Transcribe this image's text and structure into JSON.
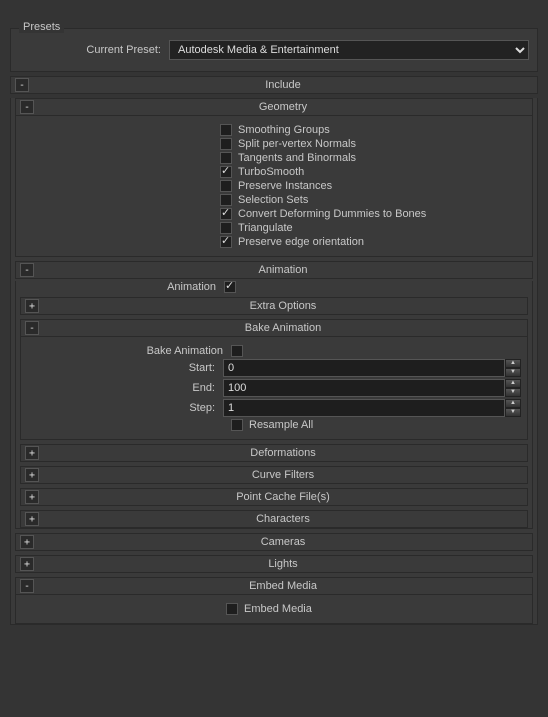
{
  "presets": {
    "legend": "Presets",
    "current_preset_label": "Current Preset:",
    "current_preset_value": "Autodesk Media & Entertainment"
  },
  "include": {
    "title": "Include",
    "toggle": "-",
    "geometry": {
      "title": "Geometry",
      "toggle": "-",
      "options": [
        {
          "label": "Smoothing Groups",
          "checked": false
        },
        {
          "label": "Split per-vertex Normals",
          "checked": false
        },
        {
          "label": "Tangents and Binormals",
          "checked": false
        },
        {
          "label": "TurboSmooth",
          "checked": true
        },
        {
          "label": "Preserve Instances",
          "checked": false
        },
        {
          "label": "Selection Sets",
          "checked": false
        },
        {
          "label": "Convert Deforming Dummies to Bones",
          "checked": true
        },
        {
          "label": "Triangulate",
          "checked": false
        },
        {
          "label": "Preserve edge orientation",
          "checked": true
        }
      ]
    },
    "animation": {
      "title": "Animation",
      "toggle": "-",
      "animation_label": "Animation",
      "animation_checked": true,
      "extra_options": {
        "title": "Extra Options",
        "toggle": "+"
      },
      "bake_animation": {
        "title": "Bake Animation",
        "toggle": "-",
        "bake_label": "Bake Animation",
        "bake_checked": false,
        "start_label": "Start:",
        "start_value": "0",
        "end_label": "End:",
        "end_value": "100",
        "step_label": "Step:",
        "step_value": "1",
        "resample_label": "Resample All",
        "resample_checked": false
      },
      "deformations": {
        "title": "Deformations",
        "toggle": "+"
      },
      "curve_filters": {
        "title": "Curve Filters",
        "toggle": "+"
      },
      "point_cache": {
        "title": "Point Cache File(s)",
        "toggle": "+"
      },
      "characters": {
        "title": "Characters",
        "toggle": "+"
      }
    },
    "cameras": {
      "title": "Cameras",
      "toggle": "+"
    },
    "lights": {
      "title": "Lights",
      "toggle": "+"
    },
    "embed_media": {
      "title": "Embed Media",
      "toggle": "-",
      "option_label": "Embed Media",
      "option_checked": false
    }
  }
}
